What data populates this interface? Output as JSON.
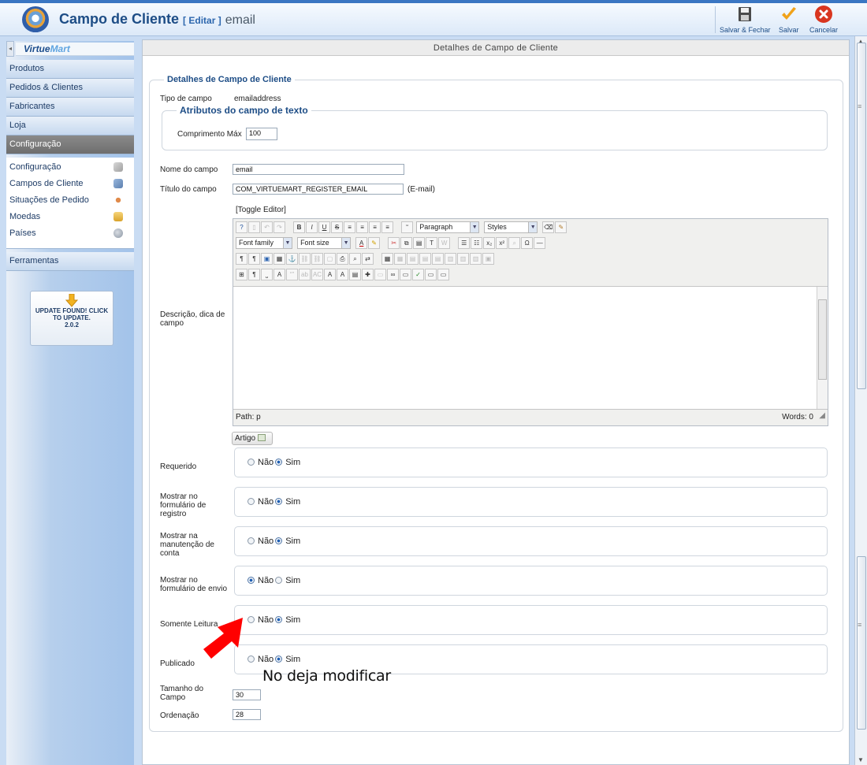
{
  "header": {
    "title": "Campo de Cliente",
    "edit_label": "[ Editar ]",
    "field_name": "email",
    "toolbar": {
      "save_close": "Salvar & Fechar",
      "save": "Salvar",
      "cancel": "Cancelar"
    }
  },
  "sidebar": {
    "logo_text_a": "Virtue",
    "logo_text_b": "Mart",
    "menu": [
      {
        "label": "Produtos"
      },
      {
        "label": "Pedidos & Clientes"
      },
      {
        "label": "Fabricantes"
      },
      {
        "label": "Loja"
      },
      {
        "label": "Configuração"
      }
    ],
    "submenu": [
      {
        "label": "Configuração"
      },
      {
        "label": "Campos de Cliente"
      },
      {
        "label": "Situações de Pedido"
      },
      {
        "label": "Moedas"
      },
      {
        "label": "Países"
      }
    ],
    "tools_label": "Ferramentas",
    "update": {
      "line1": "UPDATE FOUND! CLICK",
      "line2": "TO UPDATE.",
      "version": "2.0.2"
    }
  },
  "main": {
    "panel_title": "Detalhes de Campo de Cliente",
    "fieldset_legend": "Detalhes de Campo de Cliente",
    "field_type_label": "Tipo de campo",
    "field_type_value": "emailaddress",
    "attributes_legend": "Atributos do campo de texto",
    "max_length_label": "Comprimento Máx",
    "max_length_value": "100",
    "name_label": "Nome do campo",
    "name_value": "email",
    "title_label": "Título do campo",
    "title_value": "COM_VIRTUEMART_REGISTER_EMAIL",
    "title_hint": "(E-mail)",
    "toggle_editor": "[Toggle Editor]",
    "description_label": "Descrição, dica de campo",
    "editor": {
      "paragraph_select": "Paragraph",
      "styles_select": "Styles",
      "font_family_select": "Font family",
      "font_size_select": "Font size",
      "path_text": "Path:  p",
      "words_text": "Words: 0"
    },
    "article_button": "Artigo",
    "radio_groups": [
      {
        "label": "Requerido",
        "no": "Não",
        "yes": "Sim",
        "selected": "Sim"
      },
      {
        "label": "Mostrar no formulário de registro",
        "no": "Não",
        "yes": "Sim",
        "selected": "Sim"
      },
      {
        "label": "Mostrar na manutenção de conta",
        "no": "Não",
        "yes": "Sim",
        "selected": "Sim"
      },
      {
        "label": "Mostrar no formulário de envio",
        "no": "Não",
        "yes": "Sim",
        "selected": "Não"
      },
      {
        "label": "Somente Leitura",
        "no": "Não",
        "yes": "Sim",
        "selected": "Sim"
      },
      {
        "label": "Publicado",
        "no": "Não",
        "yes": "Sim",
        "selected": "Sim"
      }
    ],
    "size_label": "Tamanho do Campo",
    "size_value": "30",
    "order_label": "Ordenação",
    "order_value": "28"
  },
  "annotation": {
    "text": "No deja modificar",
    "color": "#ff0000"
  }
}
